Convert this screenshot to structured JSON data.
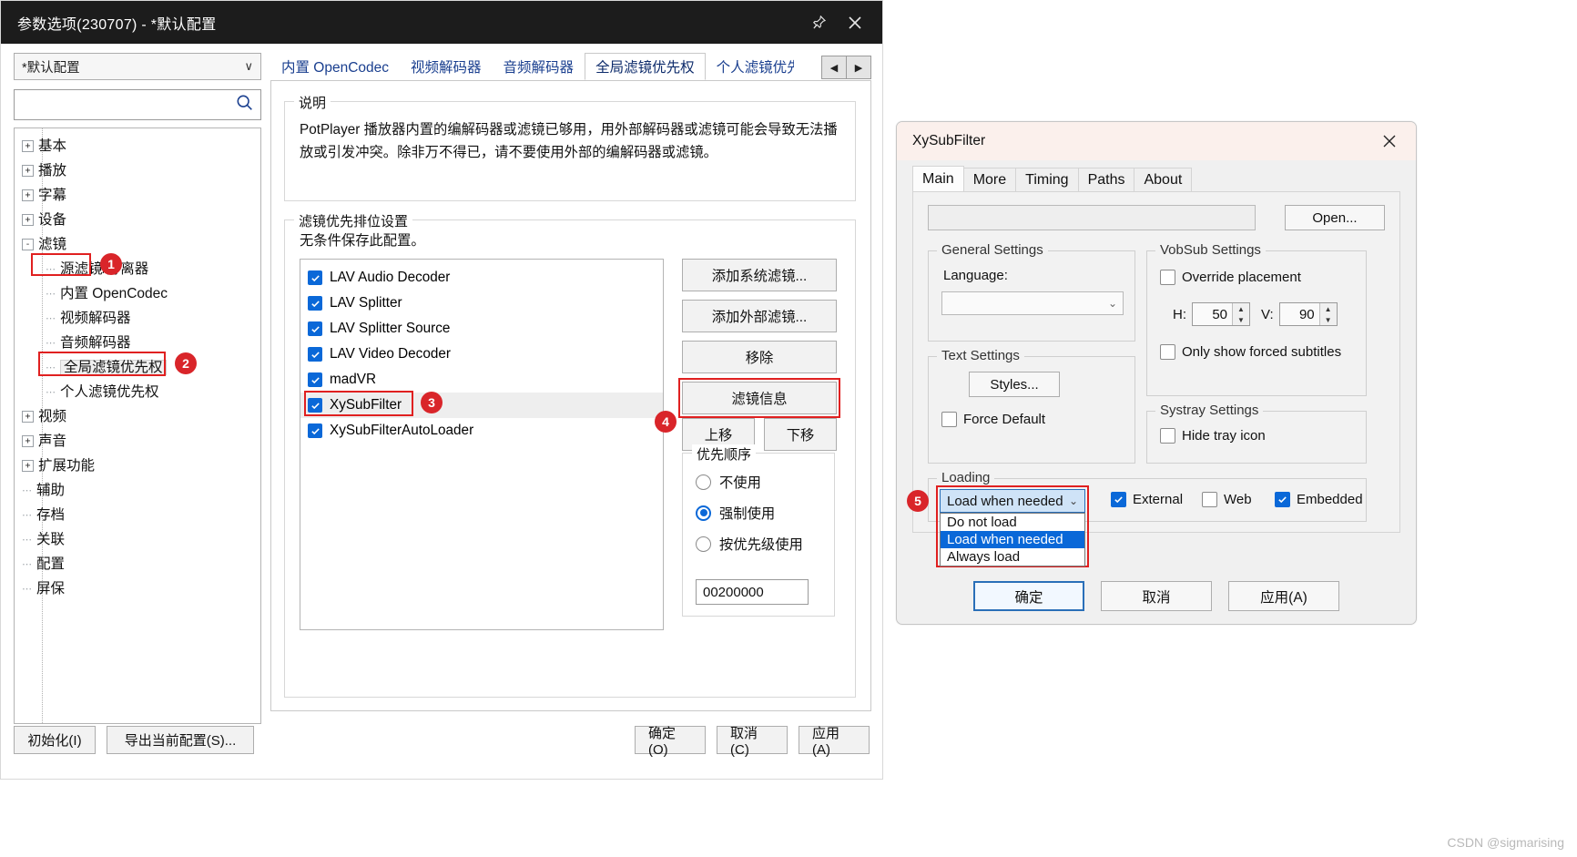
{
  "potplayer": {
    "title": "参数选项(230707) - *默认配置",
    "titlebar_icons": {
      "pin": "pin-icon",
      "close": "close-icon"
    },
    "profile": {
      "value": "*默认配置",
      "caret": "chevron-down-icon"
    },
    "search": {
      "placeholder": "",
      "icon": "search-icon"
    },
    "tree": [
      {
        "label": "基本",
        "level": 0,
        "expander": "+"
      },
      {
        "label": "播放",
        "level": 0,
        "expander": "+"
      },
      {
        "label": "字幕",
        "level": 0,
        "expander": "+"
      },
      {
        "label": "设备",
        "level": 0,
        "expander": "+"
      },
      {
        "label": "滤镜",
        "level": 0,
        "expander": "-",
        "highlight": true,
        "badge": "1"
      },
      {
        "label": "源滤镜/分离器",
        "level": 1
      },
      {
        "label": "内置 OpenCodec",
        "level": 1
      },
      {
        "label": "视频解码器",
        "level": 1
      },
      {
        "label": "音频解码器",
        "level": 1
      },
      {
        "label": "全局滤镜优先权",
        "level": 1,
        "selected": true,
        "highlight": true,
        "badge": "2"
      },
      {
        "label": "个人滤镜优先权",
        "level": 1
      },
      {
        "label": "视频",
        "level": 0,
        "expander": "+"
      },
      {
        "label": "声音",
        "level": 0,
        "expander": "+"
      },
      {
        "label": "扩展功能",
        "level": 0,
        "expander": "+"
      },
      {
        "label": "辅助",
        "level": 0
      },
      {
        "label": "存档",
        "level": 0
      },
      {
        "label": "关联",
        "level": 0
      },
      {
        "label": "配置",
        "level": 0
      },
      {
        "label": "屏保",
        "level": 0
      }
    ],
    "tabs": [
      {
        "label": "内置 OpenCodec",
        "active": false
      },
      {
        "label": "视频解码器",
        "active": false
      },
      {
        "label": "音频解码器",
        "active": false
      },
      {
        "label": "全局滤镜优先权",
        "active": true
      },
      {
        "label": "个人滤镜优先",
        "active": false
      }
    ],
    "tab_scroll": {
      "prev": "chevron-left-icon",
      "next": "chevron-right-icon"
    },
    "description": {
      "title": "说明",
      "text": "PotPlayer 播放器内置的编解码器或滤镜已够用，用外部解码器或滤镜可能会导致无法播放或引发冲突。除非万不得已，请不要使用外部的编解码器或滤镜。"
    },
    "priority_group": {
      "title": "滤镜优先排位设置",
      "note": "无条件保存此配置。",
      "filters": [
        {
          "name": "LAV Audio Decoder",
          "checked": true
        },
        {
          "name": "LAV Splitter",
          "checked": true
        },
        {
          "name": "LAV Splitter Source",
          "checked": true
        },
        {
          "name": "LAV Video Decoder",
          "checked": true
        },
        {
          "name": "madVR",
          "checked": true
        },
        {
          "name": "XySubFilter",
          "checked": true,
          "selected": true,
          "highlight": true,
          "badge": "3"
        },
        {
          "name": "XySubFilterAutoLoader",
          "checked": true
        }
      ],
      "buttons": {
        "add_system": "添加系统滤镜...",
        "add_external": "添加外部滤镜...",
        "remove": "移除",
        "filter_info": "滤镜信息",
        "filter_info_badge": "4",
        "move_up": "上移",
        "move_down": "下移"
      },
      "order": {
        "title": "优先顺序",
        "options": [
          {
            "label": "不使用",
            "selected": false
          },
          {
            "label": "强制使用",
            "selected": true
          },
          {
            "label": "按优先级使用",
            "selected": false
          }
        ],
        "value": "00200000"
      }
    },
    "bottom": {
      "init": "初始化(I)",
      "export": "导出当前配置(S)...",
      "ok": "确定(O)",
      "cancel": "取消(C)",
      "apply": "应用(A)"
    }
  },
  "xysubfilter": {
    "title": "XySubFilter",
    "close_icon": "close-icon",
    "tabs": [
      {
        "label": "Main",
        "active": true
      },
      {
        "label": "More",
        "active": false
      },
      {
        "label": "Timing",
        "active": false
      },
      {
        "label": "Paths",
        "active": false
      },
      {
        "label": "About",
        "active": false
      }
    ],
    "path_field": {
      "value": "",
      "placeholder": ""
    },
    "open_button": "Open...",
    "general": {
      "title": "General Settings",
      "language_label": "Language:",
      "language_value": "",
      "caret": "chevron-down-icon"
    },
    "text_settings": {
      "title": "Text Settings",
      "styles_button": "Styles...",
      "force_default": {
        "label": "Force Default",
        "checked": false
      }
    },
    "vobsub": {
      "title": "VobSub Settings",
      "override_placement": {
        "label": "Override placement",
        "checked": false
      },
      "h_label": "H:",
      "h_value": "50",
      "v_label": "V:",
      "v_value": "90",
      "only_forced": {
        "label": "Only show forced subtitles",
        "checked": false
      }
    },
    "systray": {
      "title": "Systray Settings",
      "hide_tray": {
        "label": "Hide tray icon",
        "checked": false
      }
    },
    "loading": {
      "title": "Loading",
      "badge": "5",
      "combo_value": "Load when needed",
      "caret": "chevron-down-icon",
      "options": [
        {
          "label": "Do not load",
          "selected": false
        },
        {
          "label": "Load when needed",
          "selected": true
        },
        {
          "label": "Always load",
          "selected": false
        }
      ],
      "external": {
        "label": "External",
        "checked": true
      },
      "web": {
        "label": "Web",
        "checked": false
      },
      "embedded": {
        "label": "Embedded",
        "checked": true
      }
    },
    "buttons": {
      "ok": "确定",
      "cancel": "取消",
      "apply": "应用(A)"
    }
  },
  "watermark": "CSDN @sigmarising",
  "colors": {
    "accent": "#0a68d8",
    "annotation": "#e02020",
    "badge": "#d9252a",
    "titlebar": "#1c1c1c"
  }
}
